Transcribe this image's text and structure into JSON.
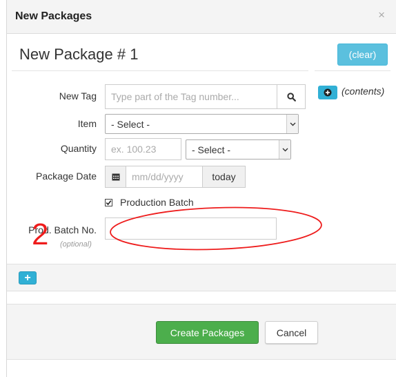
{
  "colors": {
    "info": "#5bc0de",
    "success": "#4cae4c",
    "annotation": "#ee1c1c"
  },
  "modal": {
    "title": "New Packages",
    "close_label": "×"
  },
  "package": {
    "title": "New Package # 1",
    "clear_label": "(clear)"
  },
  "form": {
    "tag": {
      "label": "New Tag",
      "placeholder": "Type part of the Tag number...",
      "search_icon": "search-icon"
    },
    "contents_label": "(contents)",
    "item": {
      "label": "Item",
      "value": "- Select -"
    },
    "quantity": {
      "label": "Quantity",
      "placeholder": "ex. 100.23",
      "unit_value": "- Select -"
    },
    "package_date": {
      "label": "Package Date",
      "placeholder": "mm/dd/yyyy",
      "today_label": "today",
      "calendar_icon": "calendar-icon"
    },
    "production_batch": {
      "label": "Production Batch",
      "checked": true
    },
    "batch_no": {
      "label": "Prod. Batch No.",
      "optional": "(optional)",
      "value": ""
    }
  },
  "add_button_label": "+",
  "footer": {
    "create_label": "Create Packages",
    "cancel_label": "Cancel"
  },
  "annotation": {
    "number": "2"
  }
}
